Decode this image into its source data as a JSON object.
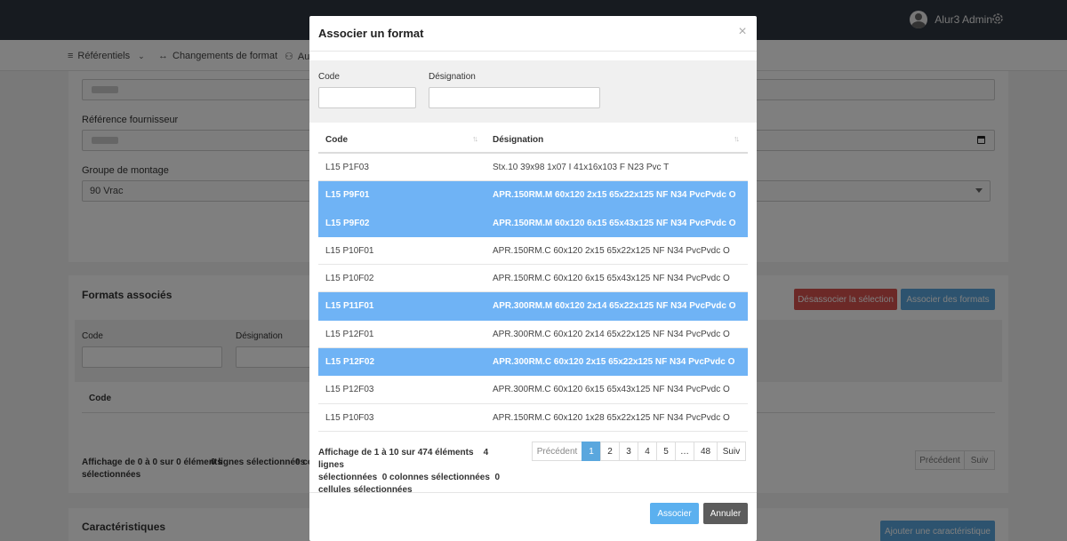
{
  "header": {
    "user_name": "Alur3 Admin"
  },
  "nav": {
    "items": [
      {
        "label": "Référentiels",
        "icon": "database-icon"
      },
      {
        "label": "Changements de format",
        "icon": "swap-arrows-icon"
      },
      {
        "label": "Au",
        "icon": "users-icon"
      }
    ]
  },
  "form": {
    "ref_fournisseur_label": "Référence fournisseur",
    "groupe_label": "Groupe de montage",
    "groupe_value": "90 Vrac"
  },
  "formats_section": {
    "title": "Formats associés",
    "btn_dissociate": "Désassocier la sélection",
    "btn_associate": "Associer des formats",
    "filter_code_label": "Code",
    "filter_designation_label": "Désignation",
    "col_code": "Code",
    "info": "Affichage de 0 à 0 sur 0 éléments",
    "info_selected": "0 lignes sélectionnées",
    "info_cut": "0 co",
    "info_tail": "sélectionnées",
    "prev": "Précédent",
    "next": "Suiv"
  },
  "characteristics_section": {
    "title": "Caractéristiques",
    "btn_add": "Ajouter une caractéristique"
  },
  "modal": {
    "title": "Associer un format",
    "filter_code_label": "Code",
    "filter_designation_label": "Désignation",
    "columns": {
      "code": "Code",
      "designation": "Désignation"
    },
    "rows": [
      {
        "code": "L15 P1F03",
        "designation": "Stx.10 39x98 1x07 I 41x16x103 F N23 Pvc T",
        "selected": false
      },
      {
        "code": "L15 P9F01",
        "designation": "APR.150RM.M 60x120 2x15 65x22x125 NF N34 PvcPvdc O",
        "selected": true
      },
      {
        "code": "L15 P9F02",
        "designation": "APR.150RM.M 60x120 6x15 65x43x125 NF N34 PvcPvdc O",
        "selected": true
      },
      {
        "code": "L15 P10F01",
        "designation": "APR.150RM.C 60x120 2x15 65x22x125 NF N34 PvcPvdc O",
        "selected": false
      },
      {
        "code": "L15 P10F02",
        "designation": "APR.150RM.C 60x120 6x15 65x43x125 NF N34 PvcPvdc O",
        "selected": false
      },
      {
        "code": "L15 P11F01",
        "designation": "APR.300RM.M 60x120 2x14 65x22x125 NF N34 PvcPvdc O",
        "selected": true
      },
      {
        "code": "L15 P12F01",
        "designation": "APR.300RM.C 60x120 2x14 65x22x125 NF N34 PvcPvdc O",
        "selected": false
      },
      {
        "code": "L15 P12F02",
        "designation": "APR.300RM.C 60x120 2x15 65x22x125 NF N34 PvcPvdc O",
        "selected": true
      },
      {
        "code": "L15 P12F03",
        "designation": "APR.300RM.C 60x120 6x15 65x43x125 NF N34 PvcPvdc O",
        "selected": false
      },
      {
        "code": "L15 P10F03",
        "designation": "APR.150RM.C 60x120 1x28 65x22x125 NF N34 PvcPvdc O",
        "selected": false
      }
    ],
    "info_line1": "Affichage de 1 à 10 sur 474 éléments",
    "info_line1b": "4 lignes",
    "info_line2": "sélectionnées",
    "info_line2b": "0 colonnes sélectionnées",
    "info_line2c": "0",
    "info_line3": "cellules sélectionnées",
    "pagination": [
      "Précédent",
      "1",
      "2",
      "3",
      "4",
      "5",
      "…",
      "48",
      "Suiv"
    ],
    "pagination_active": "1",
    "btn_associate": "Associer",
    "btn_cancel": "Annuler"
  },
  "colors": {
    "topbar": "#2f3640",
    "selected_row": "#6fb3f5",
    "primary": "#5aa7de",
    "danger": "#d9534f"
  }
}
